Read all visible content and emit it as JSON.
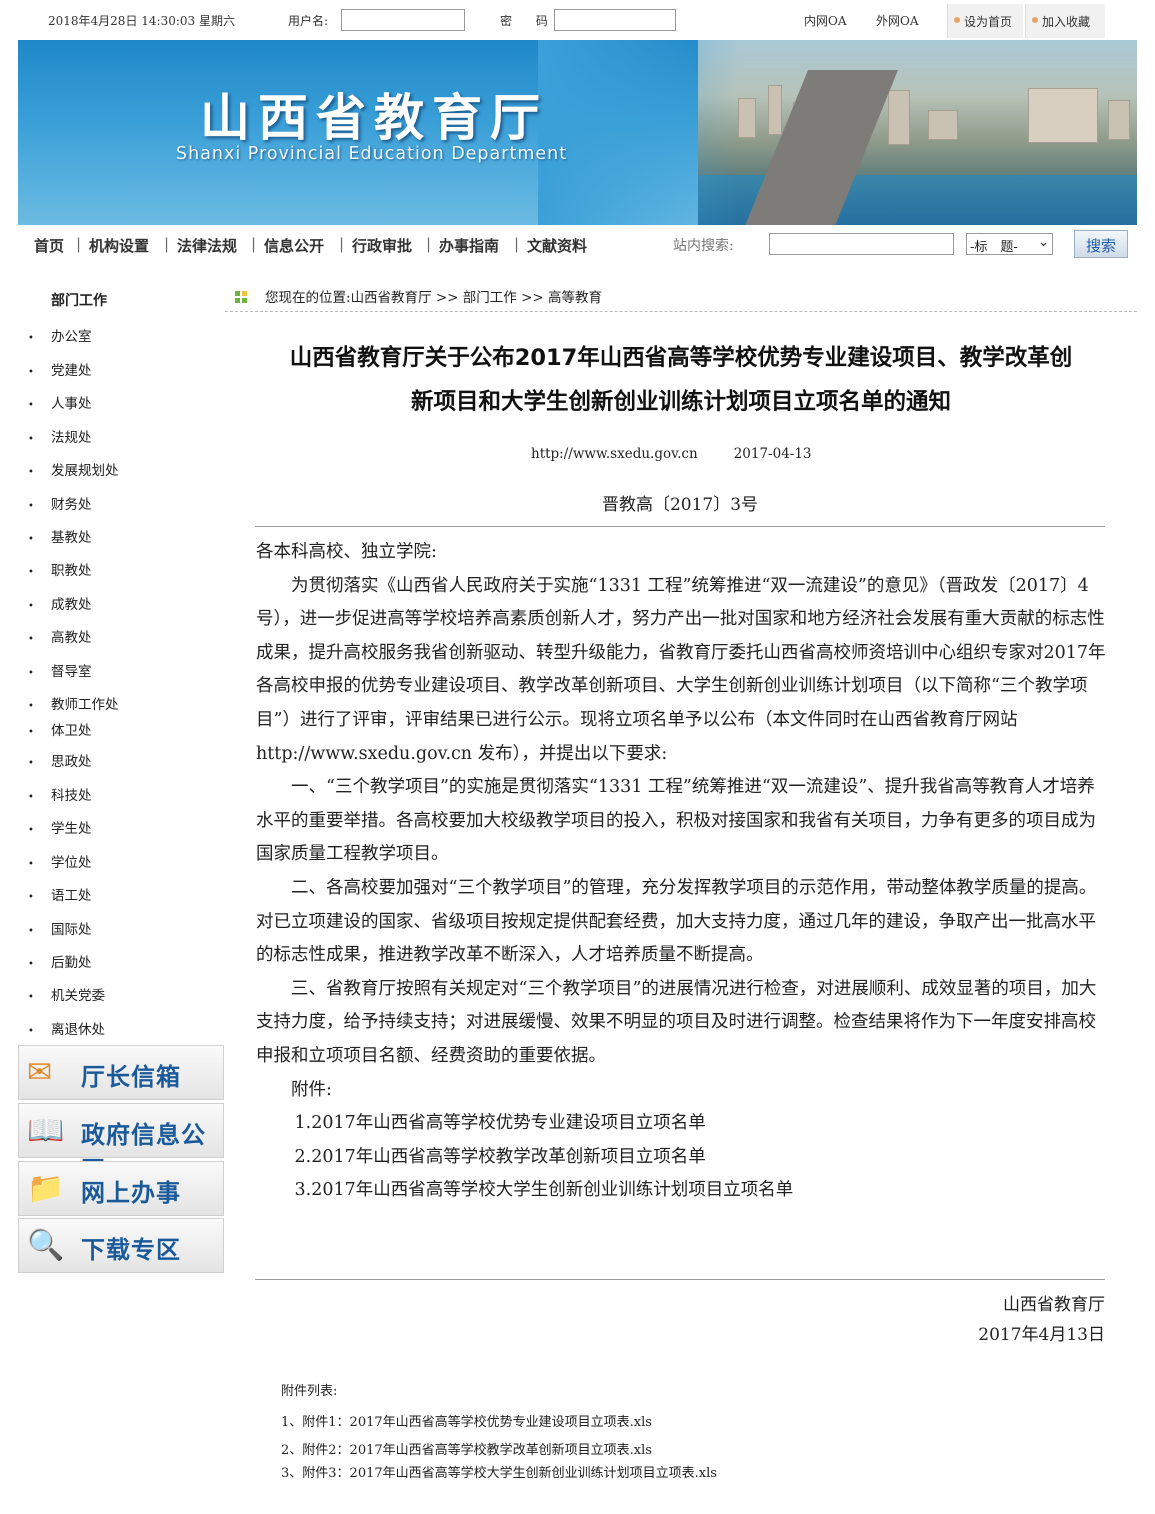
{
  "topbar": {
    "datetime": "2018年4月28日 14:30:03 星期六",
    "username_label": "用户名:",
    "password_label": "密 码:",
    "intranet_oa": "内网OA",
    "extranet_oa": "外网OA",
    "set_homepage": "设为首页",
    "add_favorite": "加入收藏"
  },
  "banner": {
    "title_cn": "山西省教育厅",
    "title_en": "Shanxi Provincial Education Department"
  },
  "nav": {
    "items": [
      "首页",
      "机构设置",
      "法律法规",
      "信息公开",
      "行政审批",
      "办事指南",
      "文献资料"
    ],
    "search_label": "站内搜索:",
    "search_select": "-标　题-",
    "search_button": "搜索"
  },
  "sidebar": {
    "title": "部门工作",
    "items": [
      "办公室",
      "党建处",
      "人事处",
      "法规处",
      "发展规划处",
      "财务处",
      "基教处",
      "职教处",
      "成教处",
      "高教处",
      "督导室",
      "教师工作处",
      "体卫处",
      "思政处",
      "科技处",
      "学生处",
      "学位处",
      "语工处",
      "国际处",
      "后勤处",
      "机关党委",
      "离退休处"
    ],
    "tiles": [
      {
        "label": "厅长信箱",
        "icon": "envelope-icon"
      },
      {
        "label": "政府信息公开",
        "icon": "book-icon"
      },
      {
        "label": "网上办事",
        "icon": "folder-icon"
      },
      {
        "label": "下载专区",
        "icon": "magnifier-icon"
      }
    ]
  },
  "breadcrumb": {
    "prefix": "您现在的位置:",
    "levels": [
      "山西省教育厅",
      "部门工作",
      "高等教育"
    ],
    "separator": ">>"
  },
  "article": {
    "title_line1": "山西省教育厅关于公布2017年山西省高等学校优势专业建设项目、教学改革创",
    "title_line2": "新项目和大学生创新创业训练计划项目立项名单的通知",
    "source": "http://www.sxedu.gov.cn",
    "date": "2017-04-13",
    "doc_number": "晋教高〔2017〕3号",
    "salutation": "各本科高校、独立学院:",
    "paragraphs": [
      "为贯彻落实《山西省人民政府关于实施“1331 工程”统筹推进“双一流建设”的意见》（晋政发〔2017〕4号），进一步促进高等学校培养高素质创新人才，努力产出一批对国家和地方经济社会发展有重大贡献的标志性成果，提升高校服务我省创新驱动、转型升级能力，省教育厅委托山西省高校师资培训中心组织专家对2017年各高校申报的优势专业建设项目、教学改革创新项目、大学生创新创业训练计划项目（以下简称“三个教学项目”）进行了评审，评审结果已进行公示。现将立项名单予以公布（本文件同时在山西省教育厅网站 http://www.sxedu.gov.cn 发布），并提出以下要求:",
      "一、“三个教学项目”的实施是贯彻落实“1331 工程”统筹推进“双一流建设”、提升我省高等教育人才培养水平的重要举措。各高校要加大校级教学项目的投入，积极对接国家和我省有关项目，力争有更多的项目成为国家质量工程教学项目。",
      "二、各高校要加强对“三个教学项目”的管理，充分发挥教学项目的示范作用，带动整体教学质量的提高。对已立项建设的国家、省级项目按规定提供配套经费，加大支持力度，通过几年的建设，争取产出一批高水平的标志性成果，推进教学改革不断深入，人才培养质量不断提高。",
      "三、省教育厅按照有关规定对“三个教学项目”的进展情况进行检查，对进展顺利、成效显著的项目，加大支持力度，给予持续支持；对进展缓慢、效果不明显的项目及时进行调整。检查结果将作为下一年度安排高校申报和立项项目名额、经费资助的重要依据。"
    ],
    "attachment_label": "附件:",
    "attachments": [
      "1.2017年山西省高等学校优势专业建设项目立项名单",
      "2.2017年山西省高等学校教学改革创新项目立项名单",
      "3.2017年山西省高等学校大学生创新创业训练计划项目立项名单"
    ],
    "signer": "山西省教育厅",
    "sign_date": "2017年4月13日"
  },
  "attachment_list": {
    "title": "附件列表:",
    "files": [
      "1、附件1：2017年山西省高等学校优势专业建设项目立项表.xls",
      "2、附件2：2017年山西省高等学校教学改革创新项目立项表.xls",
      "3、附件3：2017年山西省高等学校大学生创新创业训练计划项目立项表.xls"
    ]
  }
}
